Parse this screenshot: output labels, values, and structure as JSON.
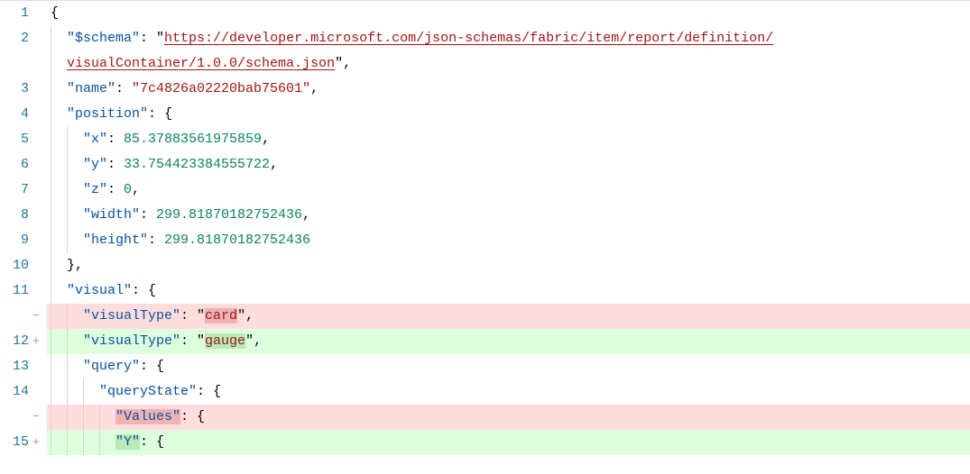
{
  "lines": [
    {
      "num": "1",
      "sign": "",
      "kind": "normal",
      "indent": 0,
      "tokens": [
        [
          "punc",
          "{"
        ]
      ]
    },
    {
      "num": "2",
      "sign": "",
      "kind": "normal",
      "indent": 1,
      "tokens": [
        [
          "key",
          "\"$schema\""
        ],
        [
          "punc",
          ": "
        ],
        [
          "punc",
          "\""
        ],
        [
          "url",
          "https://developer.microsoft.com/json-schemas/fabric/item/report/definition/"
        ]
      ]
    },
    {
      "num": "",
      "sign": "",
      "kind": "normal",
      "indent": 1,
      "tokens": [
        [
          "url",
          "visualContainer/1.0.0/schema.json"
        ],
        [
          "punc",
          "\""
        ],
        [
          "punc",
          ","
        ]
      ]
    },
    {
      "num": "3",
      "sign": "",
      "kind": "normal",
      "indent": 1,
      "tokens": [
        [
          "key",
          "\"name\""
        ],
        [
          "punc",
          ": "
        ],
        [
          "str",
          "\"7c4826a02220bab75601\""
        ],
        [
          "punc",
          ","
        ]
      ]
    },
    {
      "num": "4",
      "sign": "",
      "kind": "normal",
      "indent": 1,
      "tokens": [
        [
          "key",
          "\"position\""
        ],
        [
          "punc",
          ": {"
        ]
      ]
    },
    {
      "num": "5",
      "sign": "",
      "kind": "normal",
      "indent": 2,
      "tokens": [
        [
          "key",
          "\"x\""
        ],
        [
          "punc",
          ": "
        ],
        [
          "num",
          "85.37883561975859"
        ],
        [
          "punc",
          ","
        ]
      ]
    },
    {
      "num": "6",
      "sign": "",
      "kind": "normal",
      "indent": 2,
      "tokens": [
        [
          "key",
          "\"y\""
        ],
        [
          "punc",
          ": "
        ],
        [
          "num",
          "33.754423384555722"
        ],
        [
          "punc",
          ","
        ]
      ]
    },
    {
      "num": "7",
      "sign": "",
      "kind": "normal",
      "indent": 2,
      "tokens": [
        [
          "key",
          "\"z\""
        ],
        [
          "punc",
          ": "
        ],
        [
          "num",
          "0"
        ],
        [
          "punc",
          ","
        ]
      ]
    },
    {
      "num": "8",
      "sign": "",
      "kind": "normal",
      "indent": 2,
      "tokens": [
        [
          "key",
          "\"width\""
        ],
        [
          "punc",
          ": "
        ],
        [
          "num",
          "299.81870182752436"
        ],
        [
          "punc",
          ","
        ]
      ]
    },
    {
      "num": "9",
      "sign": "",
      "kind": "normal",
      "indent": 2,
      "tokens": [
        [
          "key",
          "\"height\""
        ],
        [
          "punc",
          ": "
        ],
        [
          "num",
          "299.81870182752436"
        ]
      ]
    },
    {
      "num": "10",
      "sign": "",
      "kind": "normal",
      "indent": 1,
      "tokens": [
        [
          "punc",
          "},"
        ]
      ]
    },
    {
      "num": "11",
      "sign": "",
      "kind": "normal",
      "indent": 1,
      "tokens": [
        [
          "key",
          "\"visual\""
        ],
        [
          "punc",
          ": {"
        ]
      ]
    },
    {
      "num": "",
      "sign": "−",
      "kind": "removed",
      "indent": 2,
      "tokens": [
        [
          "key",
          "\"visualType\""
        ],
        [
          "punc",
          ": \""
        ],
        [
          "hl",
          "card"
        ],
        [
          "punc",
          "\","
        ]
      ]
    },
    {
      "num": "12",
      "sign": "+",
      "kind": "added",
      "indent": 2,
      "tokens": [
        [
          "key",
          "\"visualType\""
        ],
        [
          "punc",
          ": \""
        ],
        [
          "hl",
          "gauge"
        ],
        [
          "punc",
          "\","
        ]
      ]
    },
    {
      "num": "13",
      "sign": "",
      "kind": "normal",
      "indent": 2,
      "tokens": [
        [
          "key",
          "\"query\""
        ],
        [
          "punc",
          ": {"
        ]
      ]
    },
    {
      "num": "14",
      "sign": "",
      "kind": "normal",
      "indent": 3,
      "tokens": [
        [
          "key",
          "\"queryState\""
        ],
        [
          "punc",
          ": {"
        ]
      ]
    },
    {
      "num": "",
      "sign": "−",
      "kind": "removed",
      "indent": 4,
      "tokens": [
        [
          "key-hl",
          "\"Values\""
        ],
        [
          "punc",
          ": {"
        ]
      ]
    },
    {
      "num": "15",
      "sign": "+",
      "kind": "added",
      "indent": 4,
      "tokens": [
        [
          "key-hl",
          "\"Y\""
        ],
        [
          "punc",
          ": {"
        ]
      ]
    }
  ]
}
